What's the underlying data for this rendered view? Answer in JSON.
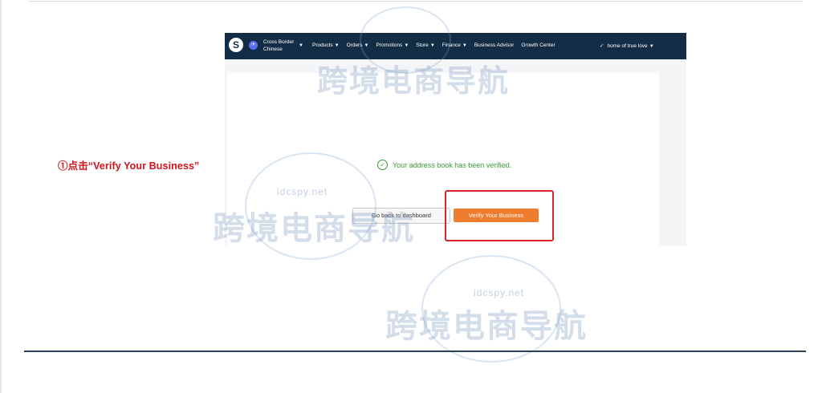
{
  "annotation": {
    "text": "①点击“Verify Your Business”"
  },
  "navbar": {
    "logo": "S",
    "store_name": "Cross Border Chinese",
    "items": [
      {
        "label": "Products"
      },
      {
        "label": "Orders"
      },
      {
        "label": "Promotions"
      },
      {
        "label": "Store"
      },
      {
        "label": "Finance"
      },
      {
        "label": "Business Advisor"
      },
      {
        "label": "Growth Center"
      }
    ],
    "user_label": "home of true love"
  },
  "main": {
    "verified_message": "Your address book has been verified.",
    "back_button": "Go back to dashboard",
    "verify_button": "Verify Your Business"
  },
  "watermark": {
    "title": "跨境电商导航",
    "site": "idcspy.net"
  },
  "colors": {
    "navbar_bg": "#142d46",
    "verify_orange": "#ee7d2e",
    "highlight_red": "#d9262b",
    "success_green": "#3a9b3a",
    "annotation_red": "#d0121b"
  }
}
